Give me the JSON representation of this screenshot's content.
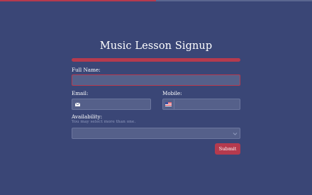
{
  "progress": {
    "value_fraction": 0.5,
    "fill_color": "#b53a4e",
    "track_color": "#5a6690"
  },
  "form": {
    "title": "Music Lesson Signup",
    "full_name": {
      "label": "Full Name:",
      "value": "",
      "placeholder": "",
      "state": "error"
    },
    "email": {
      "label": "Email:",
      "value": "",
      "placeholder": "",
      "icon": "envelope-icon"
    },
    "mobile": {
      "label": "Mobile:",
      "value": "",
      "placeholder": "",
      "icon": "us-flag-icon"
    },
    "availability": {
      "label": "Availability:",
      "hint": "You may select more than one.",
      "selected": ""
    },
    "submit_label": "Submit"
  },
  "colors": {
    "background": "#3a4676",
    "accent": "#b53a4e",
    "field_bg": "#55608a",
    "field_border": "#6b769e",
    "hint_text": "#8f99bd"
  }
}
